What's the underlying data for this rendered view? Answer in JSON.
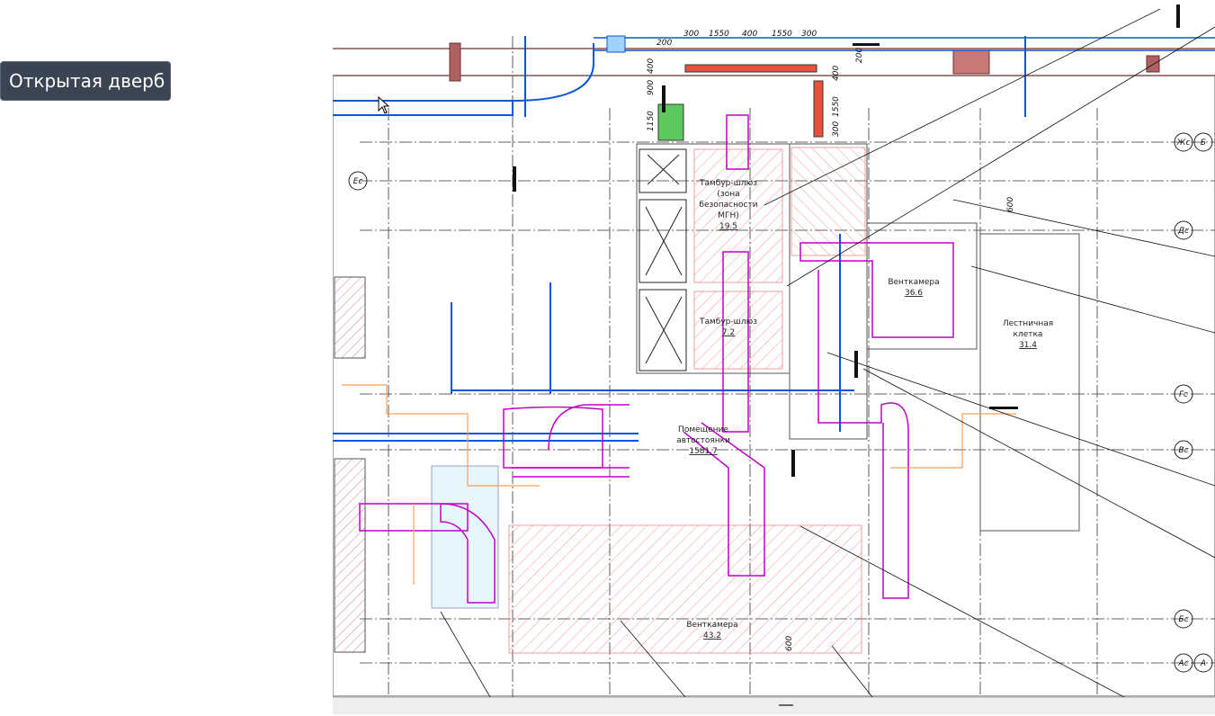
{
  "tooltip": {
    "text": "Открытая дверб"
  },
  "rooms": [
    {
      "name": "Тамбур-шлюз",
      "sub1": "(зона",
      "sub2": "безопасности",
      "sub3": "МГН)",
      "area": "19.5"
    },
    {
      "name": "Тамбур-шлюз",
      "area": "7.2"
    },
    {
      "name": "Венткамера",
      "area": "36.6"
    },
    {
      "name": "Лестничная",
      "sub1": "клетка",
      "area": "31.4"
    },
    {
      "name": "Помещение",
      "sub1": "автостоянки",
      "area": "1581.7"
    },
    {
      "name": "Венткамера",
      "area": "43.2"
    }
  ],
  "dimensions": {
    "top": [
      "200",
      "300",
      "1550",
      "400",
      "1550",
      "300"
    ],
    "right": [
      "200",
      "400",
      "1550",
      "300"
    ],
    "left": [
      "900",
      "400",
      "1150"
    ],
    "misc": [
      "600",
      "600"
    ]
  },
  "axis_labels": [
    "Ес",
    "Жс",
    "Б",
    "Дс",
    "Гс",
    "Вс",
    "Бс",
    "Ас",
    "А"
  ],
  "colors": {
    "duct_blue": "#0a56d9",
    "duct_magenta": "#c000c8",
    "hatch_red": "#e65050",
    "supply_orange": "#e8523a",
    "tooltip_bg": "#3b4452"
  },
  "icons": [
    "cursor-arrow-icon"
  ]
}
